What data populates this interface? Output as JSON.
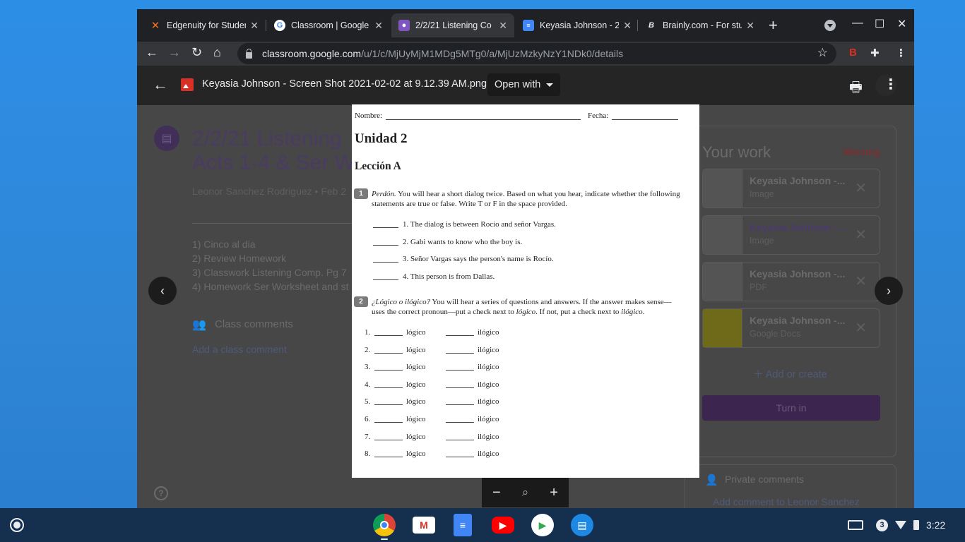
{
  "browser": {
    "tabs": [
      {
        "title": "Edgenuity for Studen",
        "icon": "edgenuity-icon",
        "active": false
      },
      {
        "title": "Classroom | Google",
        "icon": "google-icon",
        "active": false
      },
      {
        "title": "2/2/21 Listening Co",
        "icon": "classroom-icon",
        "active": true
      },
      {
        "title": "Keyasia Johnson - 2",
        "icon": "docs-icon",
        "active": false
      },
      {
        "title": "Brainly.com - For stu",
        "icon": "brainly-icon",
        "active": false
      }
    ],
    "url_host": "classroom.google.com",
    "url_path": "/u/1/c/MjUyMjM1MDg5MTg0/a/MjUzMzkyNzY1NDk0/details"
  },
  "viewer": {
    "file_name": "Keyasia Johnson - Screen Shot 2021-02-02 at 9.12.39 AM.png",
    "open_with": "Open with"
  },
  "assignment": {
    "title": "2/2/21  Listening Acts 1-4 & Ser W",
    "meta": "Leonor Sanchez Rodriguez • Feb 2",
    "body": [
      "1) Cinco al dia",
      "2) Review Homework",
      "3) Classwork Listening Comp. Pg 7",
      "4) Homework Ser Worksheet and st"
    ],
    "class_comments": "Class comments",
    "add_class_comment": "Add a class comment"
  },
  "your_work": {
    "heading": "Your work",
    "status": "Missing",
    "items": [
      {
        "name": "Keyasia Johnson -...",
        "type": "Image"
      },
      {
        "name": "Keyasia Johnson -...",
        "type": "Image"
      },
      {
        "name": "Keyasia Johnson -...",
        "type": "PDF"
      },
      {
        "name": "Keyasia Johnson -...",
        "type": "Google Docs"
      }
    ],
    "add_or_create": "Add or create",
    "turn_in": "Turn in",
    "private_comments": "Private comments",
    "add_private_comment": "Add comment to Leonor Sanchez"
  },
  "doc": {
    "nombre": "Nombre:",
    "fecha": "Fecha:",
    "unidad": "Unidad  2",
    "leccion": "Lección A",
    "section1_num": "1",
    "section1_lead": "Perdón.",
    "section1_text": " You will hear a short dialog twice. Based on what you hear, indicate whether the following statements are true or false. Write T or F in the space provided.",
    "statements": [
      "1.  The dialog is between Rocío and señor Vargas.",
      "2.  Gabi wants to know who the boy is.",
      "3.  Señor Vargas says the person's name is Rocío.",
      "4.  This person is from Dallas."
    ],
    "section2_num": "2",
    "section2_lead": "¿Lógico o ilógico?",
    "section2_text_a": " You will hear a series of questions and answers. If the answer makes sense—uses the correct pronoun—put a check next to ",
    "section2_logico": "lógico",
    "section2_text_b": ". If not, put a check next to ",
    "section2_ilogico": "ilógico",
    "section2_text_c": ".",
    "rows": [
      "1.",
      "2.",
      "3.",
      "4.",
      "5.",
      "6.",
      "7.",
      "8."
    ],
    "logico": "lógico",
    "ilogico": "ilógico"
  },
  "shelf": {
    "time": "3:22",
    "notification_count": "3"
  }
}
